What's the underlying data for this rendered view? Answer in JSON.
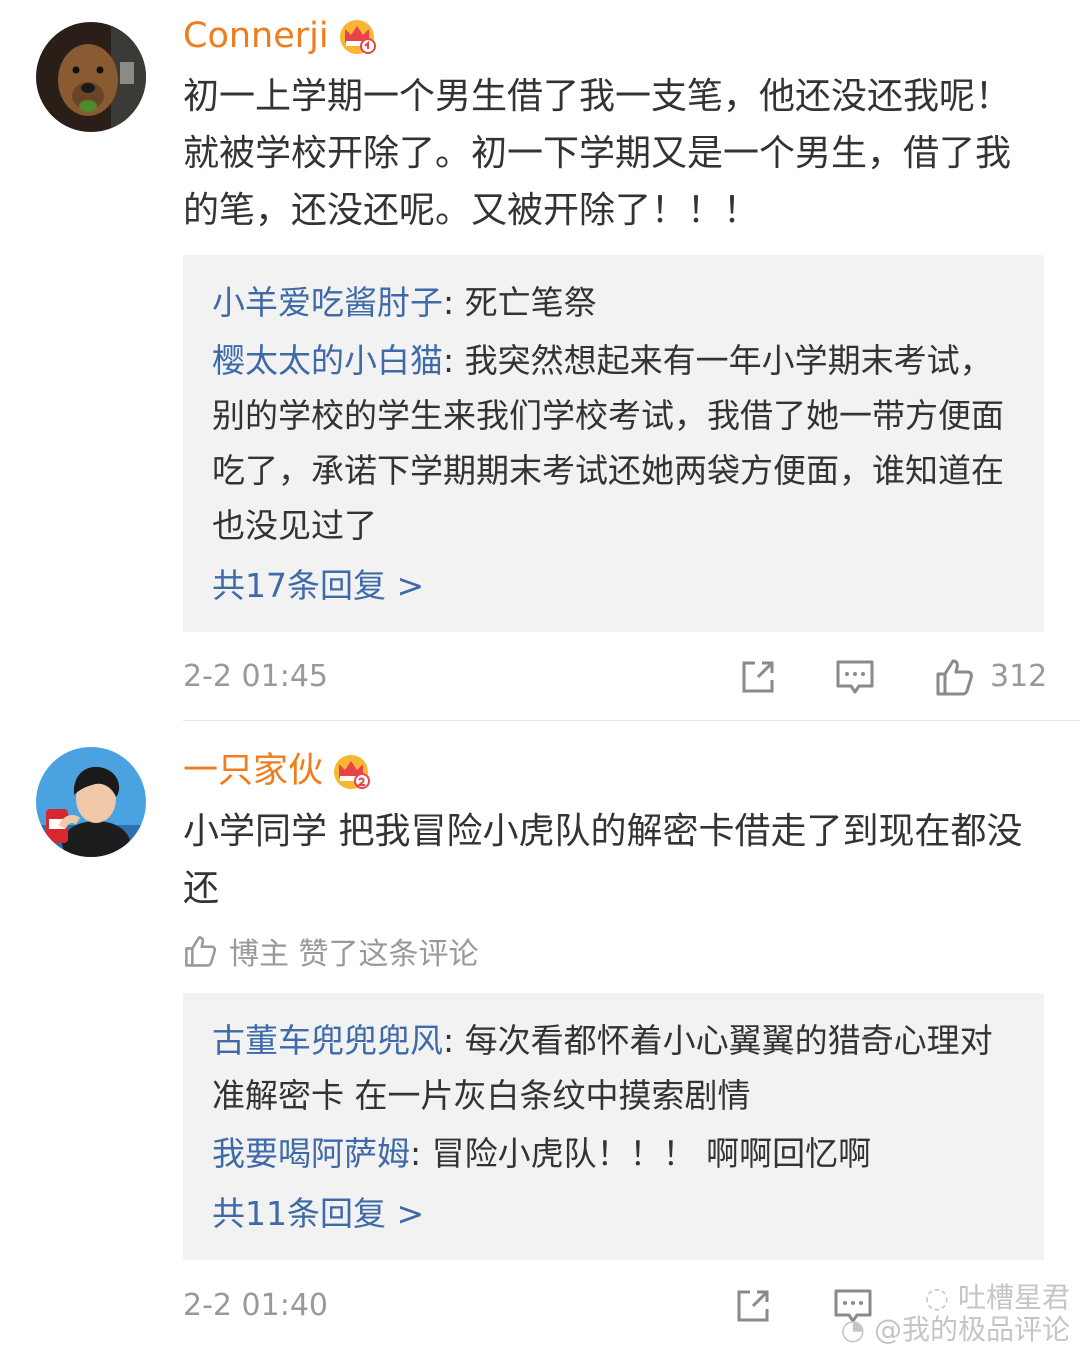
{
  "comments": [
    {
      "username": "Connerji",
      "badge_icon": "crown-icon",
      "text": "初一上学期一个男生借了我一支笔，他还没还我呢！就被学校开除了。初一下学期又是一个男生，借了我的笔，还没还呢。又被开除了！！！",
      "replies": [
        {
          "name": "小羊爱吃酱肘子",
          "text": ": 死亡笔祭"
        },
        {
          "name": "樱太太的小白猫",
          "text": ": 我突然想起来有一年小学期末考试，别的学校的学生来我们学校考试，我借了她一带方便面吃了，承诺下学期期末考试还她两袋方便面，谁知道在也没见过了"
        }
      ],
      "more_replies": "共17条回复 >",
      "timestamp": "2-2 01:45",
      "like_count": "312"
    },
    {
      "username": "一只家伙",
      "badge_icon": "crown-icon",
      "text": "小学同学 把我冒险小虎队的解密卡借走了到现在都没还",
      "liked_by_author": "博主 赞了这条评论",
      "replies": [
        {
          "name": "古董车兜兜兜风",
          "text": ": 每次看都怀着小心翼翼的猎奇心理对准解密卡 在一片灰白条纹中摸索剧情"
        },
        {
          "name": "我要喝阿萨姆",
          "text": ": 冒险小虎队！！！ 啊啊回忆啊"
        }
      ],
      "more_replies": "共11条回复 >",
      "timestamp": "2-2 01:40"
    }
  ],
  "watermark": {
    "line1": "吐槽星君",
    "line2": "@我的极品评论"
  },
  "colors": {
    "username": "#f07c1b",
    "reply_name": "#3f6aa8",
    "reply_bg": "#f2f2f2",
    "meta": "#999999"
  }
}
